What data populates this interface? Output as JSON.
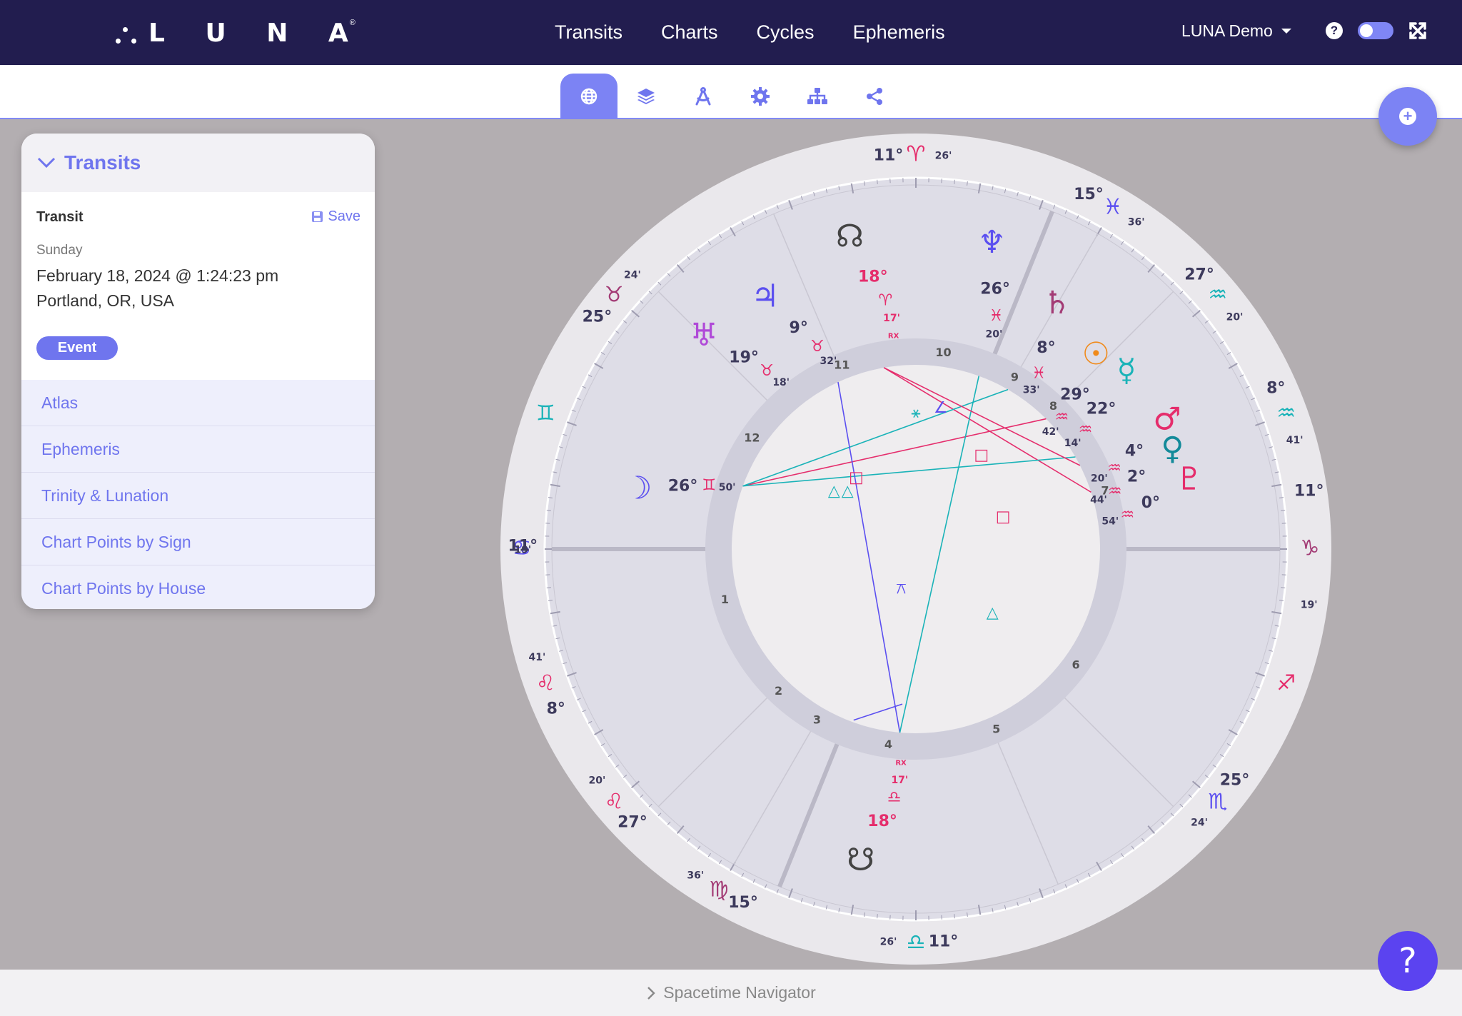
{
  "app": {
    "logo_text": "L U N A",
    "logo_reg": "®",
    "nav": [
      "Transits",
      "Charts",
      "Cycles",
      "Ephemeris"
    ],
    "user": "LUNA Demo",
    "help": "?"
  },
  "toolbar": {
    "tabs": [
      "globe-icon",
      "layers-icon",
      "compass-icon",
      "gear-icon",
      "hierarchy-icon",
      "share-icon"
    ],
    "active_tab": "globe-icon",
    "fab": "+"
  },
  "panel": {
    "title": "Transits",
    "transit_label": "Transit",
    "save_label": "Save",
    "day": "Sunday",
    "datetime": "February 18, 2024 @ 1:24:23 pm",
    "location": "Portland, OR, USA",
    "badge": "Event",
    "items": [
      "Atlas",
      "Ephemeris",
      "Trinity & Lunation",
      "Chart Points by Sign",
      "Chart Points by House"
    ]
  },
  "chart": {
    "colors": {
      "fire": "#e52d6c",
      "earth": "#a33b75",
      "air": "#1ab3b8",
      "water": "#5b4ff0",
      "ring": "#eae8ec",
      "sector": "#dedde7",
      "house_ring": "#cfcedb"
    },
    "cusps": [
      {
        "deg": "11°",
        "min": "26'",
        "sign": "♈︎"
      },
      {
        "deg": "15°",
        "min": "36'",
        "sign": "♓︎"
      },
      {
        "deg": "27°",
        "min": "20'",
        "sign": "♒︎"
      },
      {
        "deg": "8°",
        "min": "41'",
        "sign": "♒︎"
      },
      {
        "deg": "11°",
        "min": "19'",
        "sign": "♑︎"
      },
      {
        "deg": "25°",
        "min": "24'",
        "sign": "♏︎"
      },
      {
        "deg": "11°",
        "min": "26'",
        "sign": "♎︎"
      },
      {
        "deg": "15°",
        "min": "36'",
        "sign": "♍︎"
      },
      {
        "deg": "27°",
        "min": "20'",
        "sign": "♌︎"
      },
      {
        "deg": "8°",
        "min": "41'",
        "sign": "♌︎"
      },
      {
        "deg": "11°",
        "min": "19'",
        "sign": "♋︎"
      },
      {
        "deg": "25°",
        "min": "24'",
        "sign": "♉︎"
      }
    ],
    "sign_glyphs_mid": [
      {
        "sign": "♊︎"
      },
      {
        "sign": "♐︎"
      }
    ],
    "house_numbers": [
      "1",
      "2",
      "3",
      "4",
      "5",
      "6",
      "7",
      "8",
      "9",
      "10",
      "11",
      "12"
    ],
    "planets": [
      {
        "glyph": "☊",
        "deg": "18°",
        "sign": "♈︎",
        "min": "17'",
        "rx": "RX"
      },
      {
        "glyph": "♆",
        "deg": "26°",
        "sign": "♓︎",
        "min": "20'"
      },
      {
        "glyph": "♃",
        "deg": "9°",
        "sign": "♉︎",
        "min": "32'"
      },
      {
        "glyph": "♅",
        "deg": "19°",
        "sign": "♉︎",
        "min": "18'"
      },
      {
        "glyph": "♄",
        "deg": "8°",
        "sign": "♓︎",
        "min": "33'"
      },
      {
        "glyph": "☉",
        "deg": "29°",
        "sign": "♒︎",
        "min": "42'"
      },
      {
        "glyph": "☿",
        "deg": "22°",
        "sign": "♒︎",
        "min": "14'"
      },
      {
        "glyph": "♂",
        "deg": "4°",
        "sign": "♒︎",
        "min": "20'"
      },
      {
        "glyph": "♀",
        "deg": "2°",
        "sign": "♒︎",
        "min": "44'"
      },
      {
        "glyph": "♇",
        "deg": "0°",
        "sign": "♒︎",
        "min": "54'"
      },
      {
        "glyph": "☽",
        "deg": "26°",
        "sign": "♊︎",
        "min": "50'"
      },
      {
        "glyph": "☋",
        "deg": "18°",
        "sign": "♎︎",
        "min": "17'",
        "rx": "RX"
      }
    ],
    "aspect_glyphs": [
      "∠",
      "⚹",
      "□",
      "□",
      "□",
      "△",
      "△",
      "⚻",
      "△"
    ]
  },
  "footer": {
    "label": "Spacetime Navigator",
    "help": "?"
  }
}
